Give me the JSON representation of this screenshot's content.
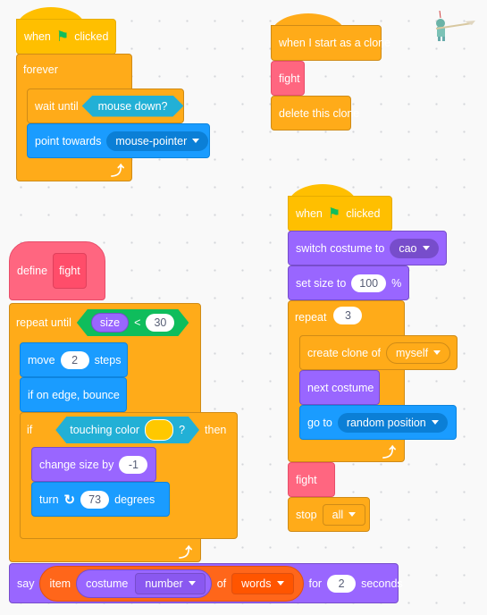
{
  "script_flag_pointer": {
    "when": "when",
    "clicked": "clicked",
    "forever": "forever",
    "wait_until": "wait until",
    "mouse_down": "mouse down?",
    "point_towards": "point towards",
    "pointer_target": "mouse-pointer"
  },
  "script_clone": {
    "hat": "when I start as a clone",
    "fight": "fight",
    "delete": "delete this clone"
  },
  "script_flag_clones": {
    "when": "when",
    "clicked": "clicked",
    "switch_costume": "switch costume to",
    "costume": "cao",
    "set_size": "set size to",
    "size": "100",
    "percent": "%",
    "repeat": "repeat",
    "repeat_count": "3",
    "create_clone": "create clone of",
    "clone_target": "myself",
    "next_costume": "next costume",
    "go_to": "go to",
    "go_target": "random position",
    "fight": "fight",
    "stop": "stop",
    "stop_option": "all"
  },
  "script_define": {
    "define": "define",
    "name": "fight",
    "repeat_until": "repeat until",
    "size": "size",
    "lt": "<",
    "limit": "30",
    "move": "move",
    "steps_val": "2",
    "steps": "steps",
    "bounce": "if on edge, bounce",
    "if": "if",
    "touching_color": "touching color",
    "q": "?",
    "then": "then",
    "touch_color": "#FFC800",
    "change_size": "change size by",
    "change_val": "-1",
    "turn": "turn",
    "turn_val": "73",
    "degrees": "degrees",
    "say": "say",
    "item": "item",
    "costume": "costume",
    "number": "number",
    "of": "of",
    "list": "words",
    "for": "for",
    "secs_val": "2",
    "seconds": "seconds"
  },
  "colors": {
    "events": "#FFBF00",
    "control": "#FFAB19",
    "motion": "#1a9cff",
    "looks": "#9966FF",
    "sensing": "#22B0D6",
    "my_blocks": "#FF6680",
    "lists": "#FF661A",
    "operators": "#0FBD5C"
  }
}
